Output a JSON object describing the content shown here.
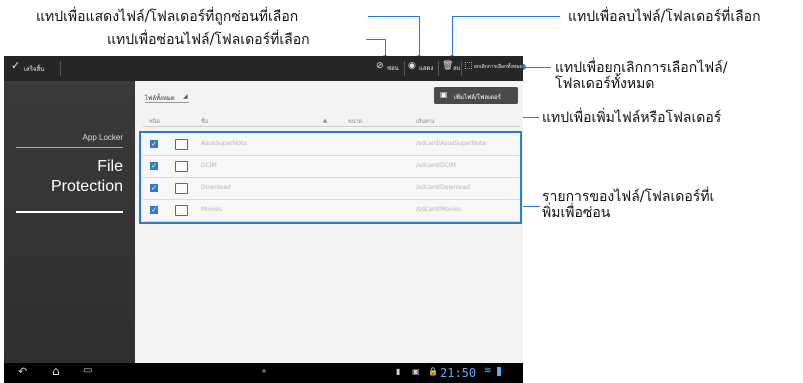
{
  "annotations": {
    "show_hidden": "แทปเพื่อแสดงไฟล์/โฟลเดอร์ที่ถูกซ่อนที่เลือก",
    "hide_selected": "แทปเพื่อซ่อนไฟล์/โฟลเดอร์ที่เลือก",
    "delete_selected": "แทปเพื่อลบไฟล์/โฟลเดอร์ที่เลือก",
    "unselect_all": "แทปเพื่อยกเลิกการเลือกไฟล์/\nโฟลเดอร์ทั้งหมด",
    "add_item": "แทปเพื่อเพิ่มไฟล์หรือโฟลเดอร์",
    "file_list": "รายการของไฟล์/โฟลเดอร์ที่เ\nพิ่มเพื่อซ่อน"
  },
  "topbar": {
    "done_label": "เสร็จสิ้น",
    "hide_label": "ซ่อน",
    "show_label": "แสดง",
    "delete_label": "ลบ",
    "unselect_all_label": "ยกเลิกการเลือกทั้งหมด"
  },
  "sidebar": {
    "app_name": "App Locker",
    "section_title_line1": "File",
    "section_title_line2": "Protection"
  },
  "content": {
    "filter_label": "ไฟล์ทั้งหมด",
    "add_button_label": "เพิ่มไฟล์/โฟลเดอร์",
    "columns": [
      "ชนิด",
      "ชื่อ",
      "ขนาด",
      "เส้นทาง"
    ],
    "rows": [
      {
        "name": "AsusSuperNote",
        "path": "/sdcard/AsusSuperNote"
      },
      {
        "name": "DCIM",
        "path": "/sdcard/DCIM"
      },
      {
        "name": "Download",
        "path": "/sdcard/Download"
      },
      {
        "name": "Movies",
        "path": "/sdcard/Movies"
      }
    ]
  },
  "statusbar": {
    "time": "21:50"
  },
  "colors": {
    "callout_line": "#2a7bd6",
    "checkbox": "#2f7ac9"
  }
}
